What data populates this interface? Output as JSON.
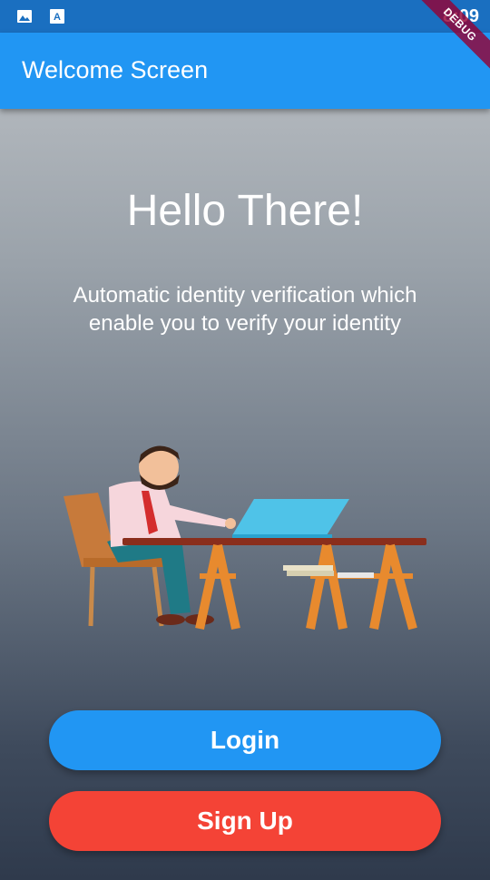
{
  "status_bar": {
    "time": "8:09",
    "icons": [
      "image-icon",
      "text-icon"
    ],
    "color": "#1a6fc0"
  },
  "app_bar": {
    "title": "Welcome Screen",
    "color": "#2196f3"
  },
  "debug_banner": "DEBUG",
  "main": {
    "headline": "Hello There!",
    "subtitle": "Automatic identity verification which enable you to verify your identity",
    "illustration": "man-at-desk-with-laptop-illustration"
  },
  "buttons": {
    "login": "Login",
    "signup": "Sign Up",
    "login_color": "#2196f3",
    "signup_color": "#f44336"
  }
}
